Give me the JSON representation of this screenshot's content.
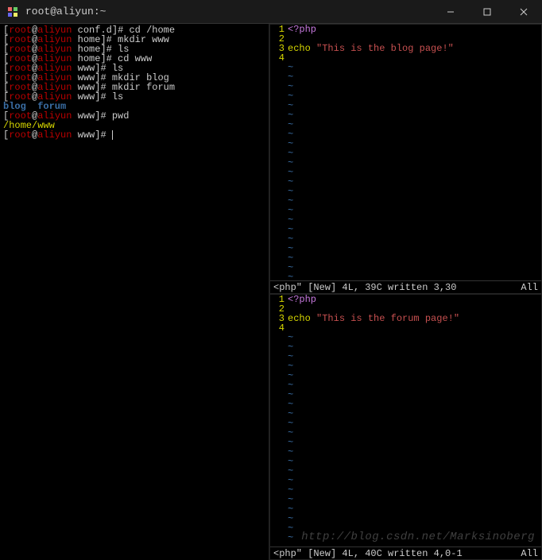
{
  "window": {
    "title": "root@aliyun:~"
  },
  "terminal": {
    "lines": [
      {
        "prompt": "[root@aliyun conf.d]#",
        "cmd": " cd /home"
      },
      {
        "prompt": "[root@aliyun home]#",
        "cmd": " mkdir www"
      },
      {
        "prompt": "[root@aliyun home]#",
        "cmd": " ls"
      },
      {
        "prompt": "[root@aliyun home]#",
        "cmd": " cd www"
      },
      {
        "prompt": "[root@aliyun www]#",
        "cmd": " ls"
      },
      {
        "prompt": "[root@aliyun www]#",
        "cmd": " mkdir blog"
      },
      {
        "prompt": "[root@aliyun www]#",
        "cmd": " mkdir forum"
      },
      {
        "prompt": "[root@aliyun www]#",
        "cmd": " ls"
      },
      {
        "out_dirs": "blog  forum"
      },
      {
        "prompt": "[root@aliyun www]#",
        "cmd": " pwd"
      },
      {
        "out_path": "/home/www"
      },
      {
        "prompt": "[root@aliyun www]#",
        "cmd": " ",
        "cursor": true
      }
    ]
  },
  "editor_top": {
    "lines": [
      {
        "n": "1",
        "php_tag": "<?php"
      },
      {
        "n": "2",
        "text": ""
      },
      {
        "n": "3",
        "echo": "echo ",
        "str": "\"This is the blog page!\"",
        "semi": ";"
      },
      {
        "n": "4",
        "text": ""
      }
    ],
    "status_left": "<php\" [New] 4L, 39C written 3,30",
    "status_right": "All"
  },
  "editor_bot": {
    "lines": [
      {
        "n": "1",
        "php_tag": "<?php"
      },
      {
        "n": "2",
        "text": ""
      },
      {
        "n": "3",
        "echo": "echo ",
        "str": "\"This is the forum page!\"",
        "semi": ";"
      },
      {
        "n": "4",
        "text": ""
      }
    ],
    "status_left": "<php\" [New] 4L, 40C written 4,0-1",
    "status_right": "All"
  },
  "watermark": "http://blog.csdn.net/Marksinoberg"
}
